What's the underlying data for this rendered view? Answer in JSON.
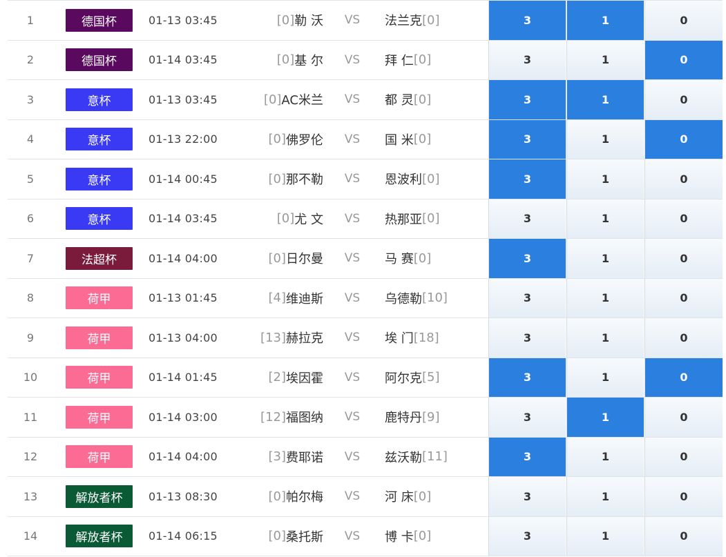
{
  "colors": {
    "highlight": "#2b7fde",
    "league": {
      "德国杯": "#5a0a5e",
      "意杯": "#3a3af5",
      "法超杯": "#7a1b3c",
      "荷甲": "#fb6b94",
      "解放者杯": "#0a5a35"
    }
  },
  "matches": [
    {
      "idx": "1",
      "league": "德国杯",
      "time": "01-13 03:45",
      "home_rank": "[0]",
      "home": "勒 沃",
      "vs": "VS",
      "away": "法兰克",
      "away_rank": "[0]",
      "opt3": "3",
      "opt1": "1",
      "opt0": "0",
      "sel": [
        true,
        true,
        false
      ]
    },
    {
      "idx": "2",
      "league": "德国杯",
      "time": "01-14 03:45",
      "home_rank": "[0]",
      "home": "基 尔",
      "vs": "VS",
      "away": "拜 仁",
      "away_rank": "[0]",
      "opt3": "3",
      "opt1": "1",
      "opt0": "0",
      "sel": [
        false,
        false,
        true
      ]
    },
    {
      "idx": "3",
      "league": "意杯",
      "time": "01-13 03:45",
      "home_rank": "[0]",
      "home": "AC米兰",
      "vs": "VS",
      "away": "都 灵",
      "away_rank": "[0]",
      "opt3": "3",
      "opt1": "1",
      "opt0": "0",
      "sel": [
        true,
        true,
        false
      ]
    },
    {
      "idx": "4",
      "league": "意杯",
      "time": "01-13 22:00",
      "home_rank": "[0]",
      "home": "佛罗伦",
      "vs": "VS",
      "away": "国 米",
      "away_rank": "[0]",
      "opt3": "3",
      "opt1": "1",
      "opt0": "0",
      "sel": [
        true,
        false,
        true
      ]
    },
    {
      "idx": "5",
      "league": "意杯",
      "time": "01-14 00:45",
      "home_rank": "[0]",
      "home": "那不勒",
      "vs": "VS",
      "away": "恩波利",
      "away_rank": "[0]",
      "opt3": "3",
      "opt1": "1",
      "opt0": "0",
      "sel": [
        true,
        false,
        false
      ]
    },
    {
      "idx": "6",
      "league": "意杯",
      "time": "01-14 03:45",
      "home_rank": "[0]",
      "home": "尤 文",
      "vs": "VS",
      "away": "热那亚",
      "away_rank": "[0]",
      "opt3": "3",
      "opt1": "1",
      "opt0": "0",
      "sel": [
        false,
        false,
        false
      ]
    },
    {
      "idx": "7",
      "league": "法超杯",
      "time": "01-14 04:00",
      "home_rank": "[0]",
      "home": "日尔曼",
      "vs": "VS",
      "away": "马 赛",
      "away_rank": "[0]",
      "opt3": "3",
      "opt1": "1",
      "opt0": "0",
      "sel": [
        true,
        false,
        false
      ]
    },
    {
      "idx": "8",
      "league": "荷甲",
      "time": "01-13 01:45",
      "home_rank": "[4]",
      "home": "维迪斯",
      "vs": "VS",
      "away": "乌德勒",
      "away_rank": "[10]",
      "opt3": "3",
      "opt1": "1",
      "opt0": "0",
      "sel": [
        false,
        false,
        false
      ]
    },
    {
      "idx": "9",
      "league": "荷甲",
      "time": "01-13 04:00",
      "home_rank": "[13]",
      "home": "赫拉克",
      "vs": "VS",
      "away": "埃 门",
      "away_rank": "[18]",
      "opt3": "3",
      "opt1": "1",
      "opt0": "0",
      "sel": [
        false,
        false,
        false
      ]
    },
    {
      "idx": "10",
      "league": "荷甲",
      "time": "01-14 01:45",
      "home_rank": "[2]",
      "home": "埃因霍",
      "vs": "VS",
      "away": "阿尔克",
      "away_rank": "[5]",
      "opt3": "3",
      "opt1": "1",
      "opt0": "0",
      "sel": [
        true,
        false,
        true
      ]
    },
    {
      "idx": "11",
      "league": "荷甲",
      "time": "01-14 03:00",
      "home_rank": "[12]",
      "home": "福图纳",
      "vs": "VS",
      "away": "鹿特丹",
      "away_rank": "[9]",
      "opt3": "3",
      "opt1": "1",
      "opt0": "0",
      "sel": [
        false,
        true,
        false
      ]
    },
    {
      "idx": "12",
      "league": "荷甲",
      "time": "01-14 04:00",
      "home_rank": "[3]",
      "home": "费耶诺",
      "vs": "VS",
      "away": "兹沃勒",
      "away_rank": "[11]",
      "opt3": "3",
      "opt1": "1",
      "opt0": "0",
      "sel": [
        true,
        false,
        false
      ]
    },
    {
      "idx": "13",
      "league": "解放者杯",
      "time": "01-13 08:30",
      "home_rank": "[0]",
      "home": "帕尔梅",
      "vs": "VS",
      "away": "河 床",
      "away_rank": "[0]",
      "opt3": "3",
      "opt1": "1",
      "opt0": "0",
      "sel": [
        false,
        false,
        false
      ]
    },
    {
      "idx": "14",
      "league": "解放者杯",
      "time": "01-14 06:15",
      "home_rank": "[0]",
      "home": "桑托斯",
      "vs": "VS",
      "away": "博 卡",
      "away_rank": "[0]",
      "opt3": "3",
      "opt1": "1",
      "opt0": "0",
      "sel": [
        false,
        false,
        false
      ]
    }
  ]
}
